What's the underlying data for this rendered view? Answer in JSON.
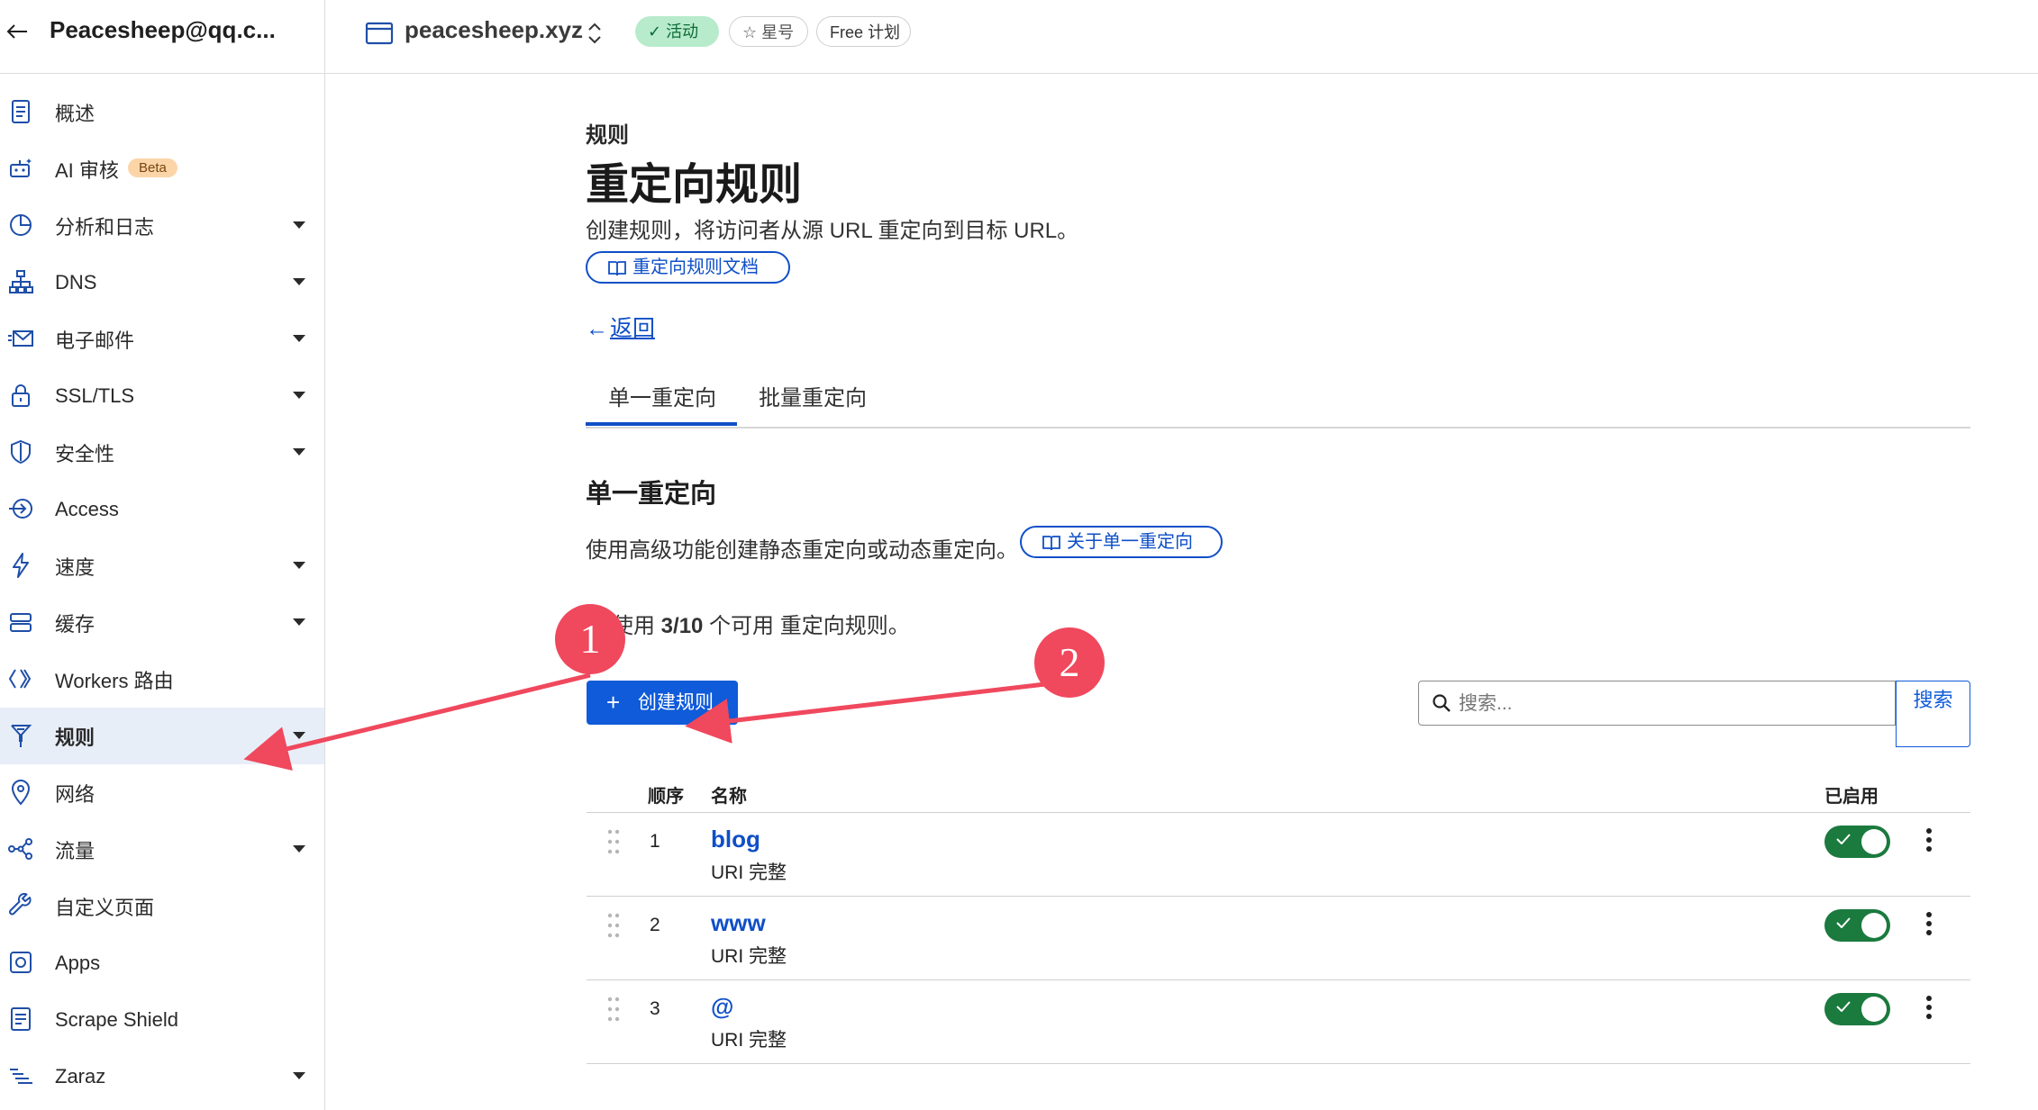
{
  "header": {
    "account": "Peacesheep@qq.c...",
    "zone": "peacesheep.xyz",
    "status_label": "活动",
    "star_label": "星号",
    "plan_label": "Free 计划"
  },
  "sidebar": {
    "items": [
      {
        "label": "概述",
        "icon": "overview-icon",
        "caret": false
      },
      {
        "label": "AI 审核",
        "icon": "ai-robot-icon",
        "caret": false,
        "badge": "Beta"
      },
      {
        "label": "分析和日志",
        "icon": "analytics-pie-icon",
        "caret": true
      },
      {
        "label": "DNS",
        "icon": "dns-tree-icon",
        "caret": true
      },
      {
        "label": "电子邮件",
        "icon": "email-icon",
        "caret": true
      },
      {
        "label": "SSL/TLS",
        "icon": "lock-icon",
        "caret": true
      },
      {
        "label": "安全性",
        "icon": "shield-icon",
        "caret": true
      },
      {
        "label": "Access",
        "icon": "access-icon",
        "caret": false
      },
      {
        "label": "速度",
        "icon": "lightning-icon",
        "caret": true
      },
      {
        "label": "缓存",
        "icon": "cache-stack-icon",
        "caret": true
      },
      {
        "label": "Workers 路由",
        "icon": "workers-icon",
        "caret": false
      },
      {
        "label": "规则",
        "icon": "rules-funnel-icon",
        "caret": true,
        "active": true
      },
      {
        "label": "网络",
        "icon": "location-pin-icon",
        "caret": false
      },
      {
        "label": "流量",
        "icon": "traffic-icon",
        "caret": true
      },
      {
        "label": "自定义页面",
        "icon": "wrench-icon",
        "caret": false
      },
      {
        "label": "Apps",
        "icon": "apps-icon",
        "caret": false
      },
      {
        "label": "Scrape Shield",
        "icon": "scrape-shield-icon",
        "caret": false
      },
      {
        "label": "Zaraz",
        "icon": "zaraz-icon",
        "caret": true
      }
    ]
  },
  "page": {
    "kicker": "规则",
    "title": "重定向规则",
    "description": "创建规则，将访问者从源 URL 重定向到目标 URL。",
    "doc_button": "重定向规则文档",
    "back_label": "返回"
  },
  "tabs": {
    "items": [
      "单一重定向",
      "批量重定向"
    ],
    "active": "单一重定向"
  },
  "single": {
    "title": "单一重定向",
    "description": "使用高级功能创建静态重定向或动态重定向。",
    "about_button": "关于单一重定向",
    "usage_prefix": "已使用 ",
    "usage_count": "3/10",
    "usage_suffix": " 个可用 重定向规则。",
    "create_button": "创建规则",
    "search_placeholder": "搜索...",
    "search_button": "搜索"
  },
  "table": {
    "headers": {
      "order": "顺序",
      "name": "名称",
      "enabled": "已启用"
    },
    "rows": [
      {
        "order": "1",
        "name": "blog",
        "type": "URI 完整",
        "enabled": true
      },
      {
        "order": "2",
        "name": "www",
        "type": "URI 完整",
        "enabled": true
      },
      {
        "order": "3",
        "name": "@",
        "type": "URI 完整",
        "enabled": true
      }
    ]
  },
  "annotations": {
    "marker_1": "1",
    "marker_2": "2",
    "marker_color": "#f0485d"
  },
  "colors": {
    "accent": "#0f4fc7",
    "primary_button": "#0f5bd9",
    "toggle_on": "#1b7a3e",
    "active_pill": "#b7ebcb"
  }
}
